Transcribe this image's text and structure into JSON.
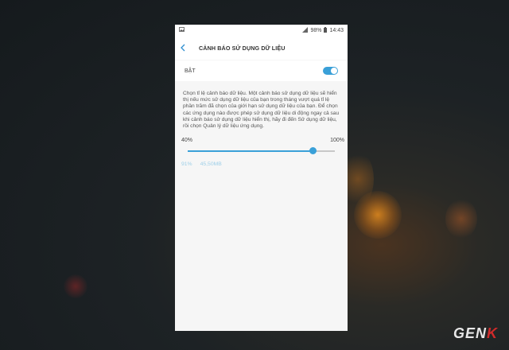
{
  "statusbar": {
    "battery": "98%",
    "time": "14:43"
  },
  "header": {
    "title": "CẢNH BÁO SỬ DỤNG DỮ LIỆU"
  },
  "toggle": {
    "label": "BẬT",
    "on": true
  },
  "description": "Chọn tỉ lệ cảnh báo dữ liệu. Một cảnh báo sử dụng dữ liệu sẽ hiển thị nếu mức sử dụng dữ liệu của bạn trong tháng vượt quá tỉ lệ phần trăm đã chọn của giới hạn sử dụng dữ liệu của bạn. Để chọn các ứng dụng nào được phép sử dụng dữ liệu di động ngay cả sau khi cảnh báo sử dụng dữ liệu hiển thị, hãy đi đến Sử dụng dữ liệu, rồi chọn Quản lý dữ liệu ứng dụng.",
  "slider": {
    "min_label": "40%",
    "max_label": "100%",
    "value_percent": 91
  },
  "current": {
    "percent": "91%",
    "amount": "45,50MB"
  },
  "logo": {
    "text_main": "GEN",
    "text_accent": "K"
  },
  "colors": {
    "accent": "#3aa0d8"
  }
}
